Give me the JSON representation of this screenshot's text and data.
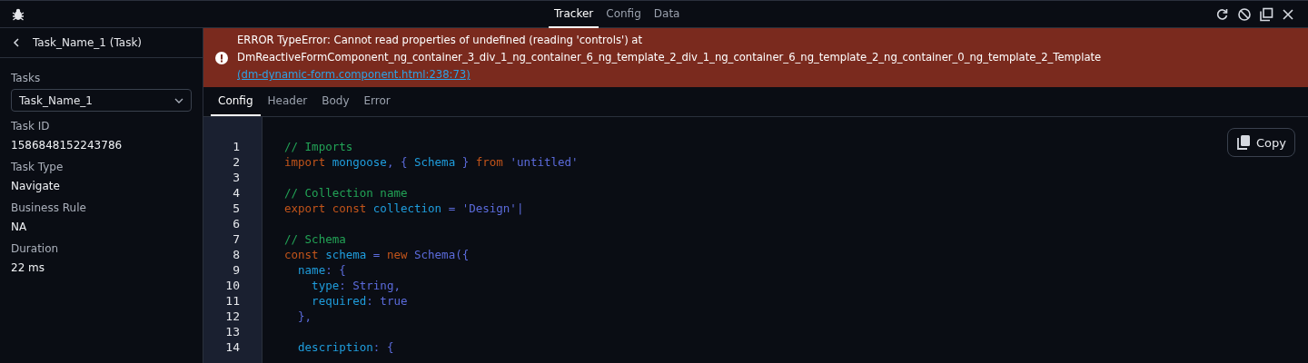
{
  "top_tabs": [
    {
      "label": "Tracker",
      "selected": true
    },
    {
      "label": "Config",
      "selected": false
    },
    {
      "label": "Data",
      "selected": false
    }
  ],
  "sidebar": {
    "title": "Task_Name_1 (Task)",
    "tasks_label": "Tasks",
    "tasks_value": "Task_Name_1",
    "fields": [
      {
        "label": "Task ID",
        "value": "1586848152243786"
      },
      {
        "label": "Task Type",
        "value": "Navigate"
      },
      {
        "label": "Business Rule",
        "value": "NA"
      },
      {
        "label": "Duration",
        "value": "22 ms"
      }
    ]
  },
  "error": {
    "lines": [
      "ERROR TypeError: Cannot read properties of undefined (reading 'controls') at",
      "DmReactiveFormComponent_ng_container_3_div_1_ng_container_6_ng_template_2_div_1_ng_container_6_ng_template_2_ng_container_0_ng_template_2_Template"
    ],
    "link": "(dm-dynamic-form.component.html:238:73)"
  },
  "tabs": [
    {
      "label": "Config",
      "selected": true
    },
    {
      "label": "Header",
      "selected": false
    },
    {
      "label": "Body",
      "selected": false
    },
    {
      "label": "Error",
      "selected": false
    }
  ],
  "copy_button": "Copy",
  "code": [
    {
      "number": "1",
      "tokens": [
        {
          "kind": "comment",
          "text": "// Imports"
        }
      ]
    },
    {
      "number": "2",
      "tokens": [
        {
          "kind": "keyword",
          "text": "import "
        },
        {
          "kind": "identifier",
          "text": "mongoose"
        },
        {
          "kind": "punctuation",
          "text": ", { "
        },
        {
          "kind": "identifier",
          "text": "Schema"
        },
        {
          "kind": "punctuation",
          "text": " } "
        },
        {
          "kind": "keyword",
          "text": "from "
        },
        {
          "kind": "string",
          "text": "'untitled'"
        }
      ]
    },
    {
      "number": "3"
    },
    {
      "number": "4",
      "tokens": [
        {
          "kind": "comment",
          "text": "// Collection name"
        }
      ]
    },
    {
      "number": "5",
      "tokens": [
        {
          "kind": "keyword",
          "text": "export const "
        },
        {
          "kind": "identifier",
          "text": "collection"
        },
        {
          "kind": "punctuation",
          "text": " = "
        },
        {
          "kind": "string",
          "text": "'Design'|"
        }
      ]
    },
    {
      "number": "6"
    },
    {
      "number": "7",
      "tokens": [
        {
          "kind": "comment",
          "text": "// Schema"
        }
      ]
    },
    {
      "number": "8",
      "tokens": [
        {
          "kind": "keyword",
          "text": "const "
        },
        {
          "kind": "identifier",
          "text": "schema"
        },
        {
          "kind": "punctuation",
          "text": " = "
        },
        {
          "kind": "keyword",
          "text": "new "
        },
        {
          "kind": "string",
          "text": "Schema({"
        }
      ]
    },
    {
      "number": "9",
      "tokens": [
        {
          "kind": "identifier",
          "text": "  name"
        },
        {
          "kind": "punctuation",
          "text": ": {"
        }
      ]
    },
    {
      "number": "10",
      "tokens": [
        {
          "kind": "identifier",
          "text": "    type"
        },
        {
          "kind": "punctuation",
          "text": ": String,"
        }
      ]
    },
    {
      "number": "11",
      "tokens": [
        {
          "kind": "identifier",
          "text": "    required"
        },
        {
          "kind": "punctuation",
          "text": ": true"
        }
      ]
    },
    {
      "number": "12",
      "tokens": [
        {
          "kind": "punctuation",
          "text": "  },"
        }
      ]
    },
    {
      "number": "13"
    },
    {
      "number": "14",
      "tokens": [
        {
          "kind": "identifier",
          "text": "  description"
        },
        {
          "kind": "punctuation",
          "text": ": {"
        }
      ]
    }
  ]
}
